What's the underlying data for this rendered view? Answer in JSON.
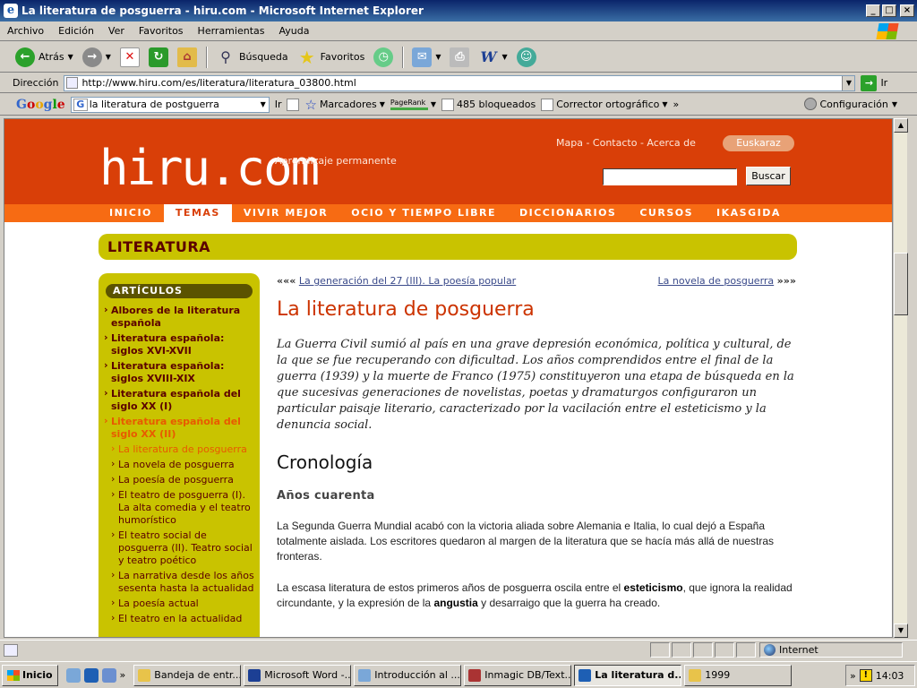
{
  "window": {
    "title": "La literatura de posguerra - hiru.com - Microsoft Internet Explorer",
    "minimize": "_",
    "maximize": "□",
    "close": "×"
  },
  "menu": [
    "Archivo",
    "Edición",
    "Ver",
    "Favoritos",
    "Herramientas",
    "Ayuda"
  ],
  "toolbar": {
    "back_label": "Atrás",
    "search_label": "Búsqueda",
    "favorites_label": "Favoritos"
  },
  "address": {
    "label": "Dirección",
    "url": "http://www.hiru.com/es/literatura/literatura_03800.html",
    "go_label": "Ir"
  },
  "google_bar": {
    "logo": "Google",
    "query": "la literatura de postguerra",
    "search_label": "Ir",
    "bookmarks_label": "Marcadores",
    "pagerank_label": "PageRank",
    "blocked_label": "485 bloqueados",
    "spellcheck_label": "Corrector ortográfico",
    "more": "»",
    "settings_label": "Configuración"
  },
  "site": {
    "logo": "hiru.com",
    "tagline": "Aprendizaje permanente",
    "top_links": "Mapa - Contacto - Acerca de",
    "language_button": "Euskaraz",
    "search_button": "Buscar",
    "nav": [
      "INICIO",
      "TEMAS",
      "VIVIR MEJOR",
      "OCIO Y TIEMPO LIBRE",
      "DICCIONARIOS",
      "CURSOS",
      "IKASGIDA"
    ],
    "nav_active_index": 1,
    "section_title": "LITERATURA"
  },
  "sidebar": {
    "heading": "ARTÍCULOS",
    "items": [
      {
        "label": "Albores de la literatura española",
        "level": 1,
        "current": false
      },
      {
        "label": "Literatura española: siglos XVI-XVII",
        "level": 1,
        "current": false
      },
      {
        "label": "Literatura española: siglos XVIII-XIX",
        "level": 1,
        "current": false
      },
      {
        "label": "Literatura española del siglo XX (I)",
        "level": 1,
        "current": false
      },
      {
        "label": "Literatura española del siglo XX (II)",
        "level": 1,
        "current": true
      },
      {
        "label": "La literatura de posguerra",
        "level": 2,
        "current": true
      },
      {
        "label": "La novela de posguerra",
        "level": 2,
        "current": false
      },
      {
        "label": "La poesía de posguerra",
        "level": 2,
        "current": false
      },
      {
        "label": "El teatro de posguerra (I). La alta comedia y el teatro humorístico",
        "level": 2,
        "current": false
      },
      {
        "label": "El teatro social de posguerra (II). Teatro social y teatro poético",
        "level": 2,
        "current": false
      },
      {
        "label": "La narrativa desde los años sesenta hasta la actualidad",
        "level": 2,
        "current": false
      },
      {
        "label": "La poesía actual",
        "level": 2,
        "current": false
      },
      {
        "label": "El teatro en la actualidad",
        "level": 2,
        "current": false
      }
    ]
  },
  "article": {
    "prev_arrows": "«««",
    "prev_link": "La generación del 27 (III). La poesía popular",
    "next_link": "La novela de posguerra",
    "next_arrows": "»»»",
    "title": "La literatura de posguerra",
    "intro": "La Guerra Civil sumió al país en una grave depresión económica, política y cultural, de la que se fue recuperando con dificultad. Los años comprendidos entre el final de la guerra (1939) y la muerte de Franco (1975) constituyeron una etapa de búsqueda en la que sucesivas generaciones de novelistas, poetas y dramaturgos configuraron un particular paisaje literario, caracterizado por la vacilación entre el esteticismo y la denuncia social.",
    "h2": "Cronología",
    "h3": "Años cuarenta",
    "p1": "La Segunda Guerra Mundial acabó con la victoria aliada sobre Alemania e Italia, lo cual dejó a España totalmente aislada. Los escritores quedaron al margen de la literatura que se hacía más allá de nuestras fronteras.",
    "p2_a": "La escasa literatura de estos primeros años de posguerra oscila entre el ",
    "p2_b1": "esteticismo",
    "p2_c": ", que ignora la realidad circundante, y la expresión de la ",
    "p2_b2": "angustia",
    "p2_d": " y desarraigo que la guerra ha creado."
  },
  "status": {
    "zone": "Internet"
  },
  "taskbar": {
    "start": "Inicio",
    "tasks": [
      {
        "label": "Bandeja de entr...",
        "color": "#e8c34a",
        "active": false
      },
      {
        "label": "Microsoft Word -...",
        "color": "#1c3f94",
        "active": false
      },
      {
        "label": "Introducción al ...",
        "color": "#7aa7d8",
        "active": false
      },
      {
        "label": "Inmagic DB/Text...",
        "color": "#a33",
        "active": false
      },
      {
        "label": "La literatura d...",
        "color": "#1e5fb4",
        "active": true
      },
      {
        "label": "1999",
        "color": "#e8c34a",
        "active": false
      }
    ],
    "more": "»",
    "clock": "14:03"
  }
}
